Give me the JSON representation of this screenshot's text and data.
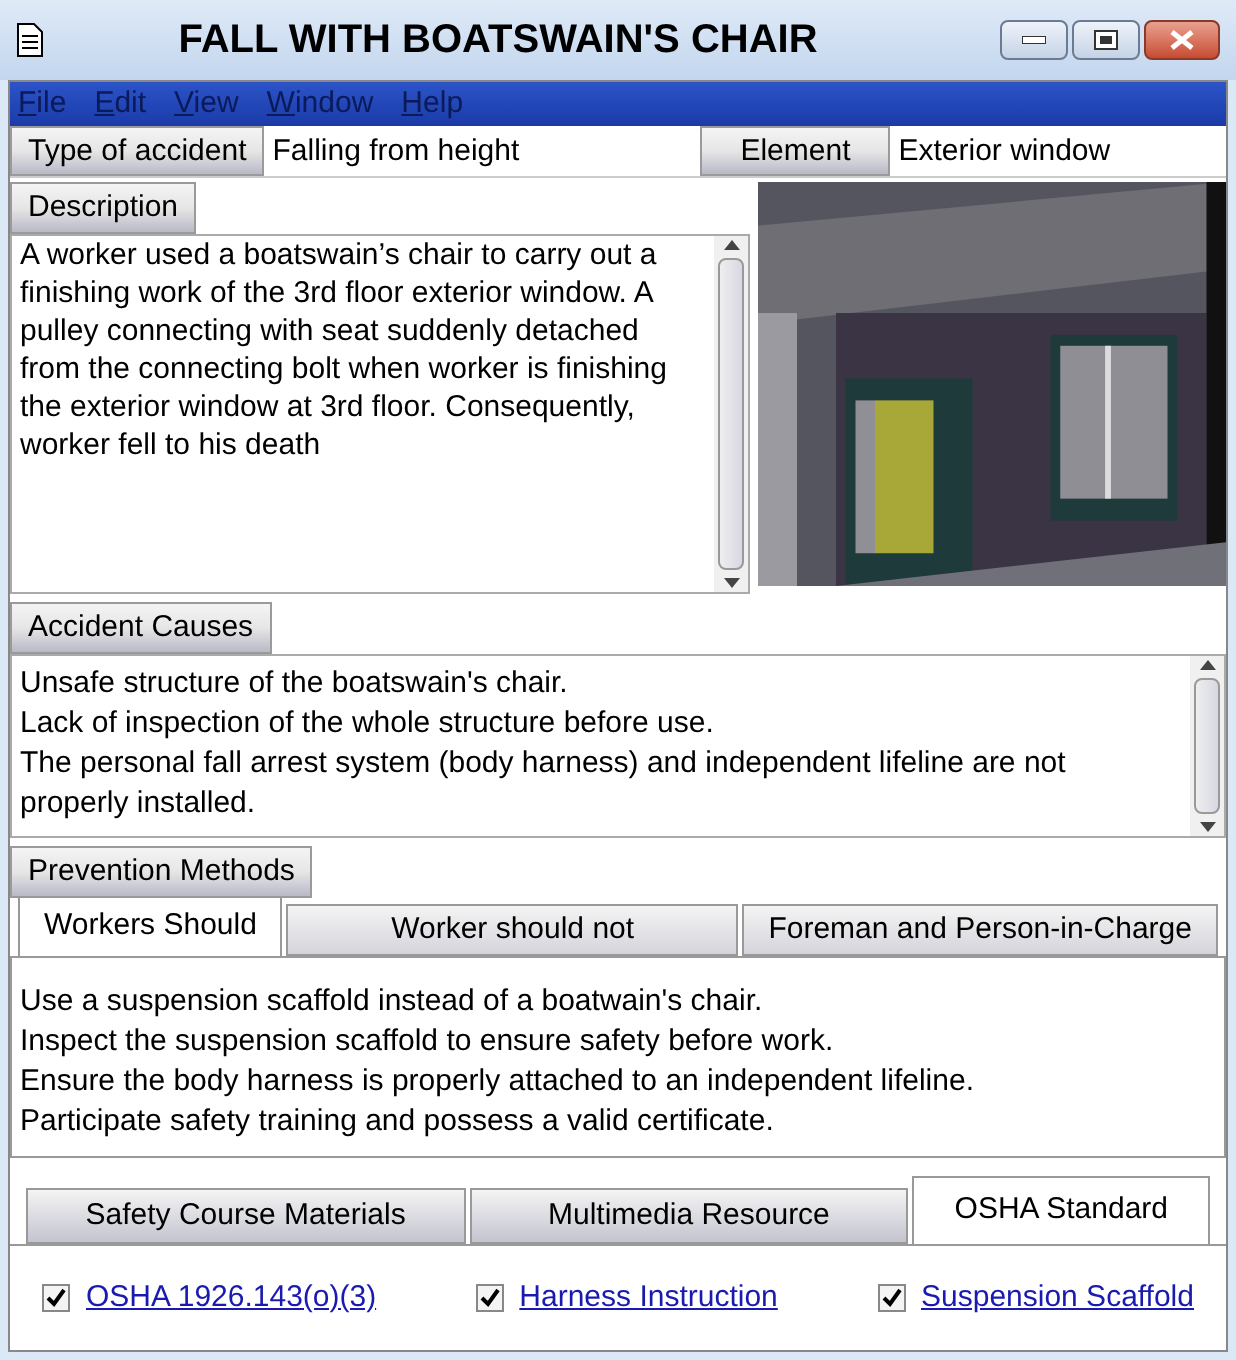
{
  "window": {
    "title": "FALL WITH BOATSWAIN'S CHAIR"
  },
  "menu": [
    "File",
    "Edit",
    "View",
    "Window",
    "Help"
  ],
  "type_of_accident": {
    "label": "Type of accident",
    "value": "Falling from height"
  },
  "element": {
    "label": "Element",
    "value": "Exterior window"
  },
  "description": {
    "label": "Description",
    "text": "A worker used a boatswain’s chair to carry out a finishing work of the 3rd floor exterior window. A pulley connecting with seat suddenly detached from the connecting bolt when worker is finishing the exterior window at 3rd floor. Consequently, worker fell to his death"
  },
  "accident_causes": {
    "label": "Accident Causes",
    "lines": [
      "Unsafe structure of the boatswain's chair.",
      "Lack of inspection of the whole structure before use.",
      "The personal fall arrest system (body harness) and independent lifeline are not properly installed."
    ]
  },
  "prevention_methods": {
    "label": "Prevention Methods",
    "tabs": [
      {
        "label": "Workers Should",
        "selected": true
      },
      {
        "label": "Worker should not",
        "selected": false
      },
      {
        "label": "Foreman and Person-in-Charge",
        "selected": false
      }
    ],
    "lines": [
      "Use a suspension scaffold instead of a boatwain's chair.",
      "Inspect the suspension scaffold to ensure safety before work.",
      "Ensure the body harness is properly attached to an independent lifeline.",
      "Participate safety training and possess a valid certificate."
    ]
  },
  "resource_tabs": [
    {
      "label": "Safety Course Materials",
      "selected": false
    },
    {
      "label": "Multimedia Resource",
      "selected": false
    },
    {
      "label": "OSHA Standard",
      "selected": true
    }
  ],
  "links": [
    {
      "label": "OSHA 1926.143(o)(3)",
      "checked": true
    },
    {
      "label": "Harness Instruction",
      "checked": true
    },
    {
      "label": "Suspension Scaffold",
      "checked": true
    }
  ]
}
